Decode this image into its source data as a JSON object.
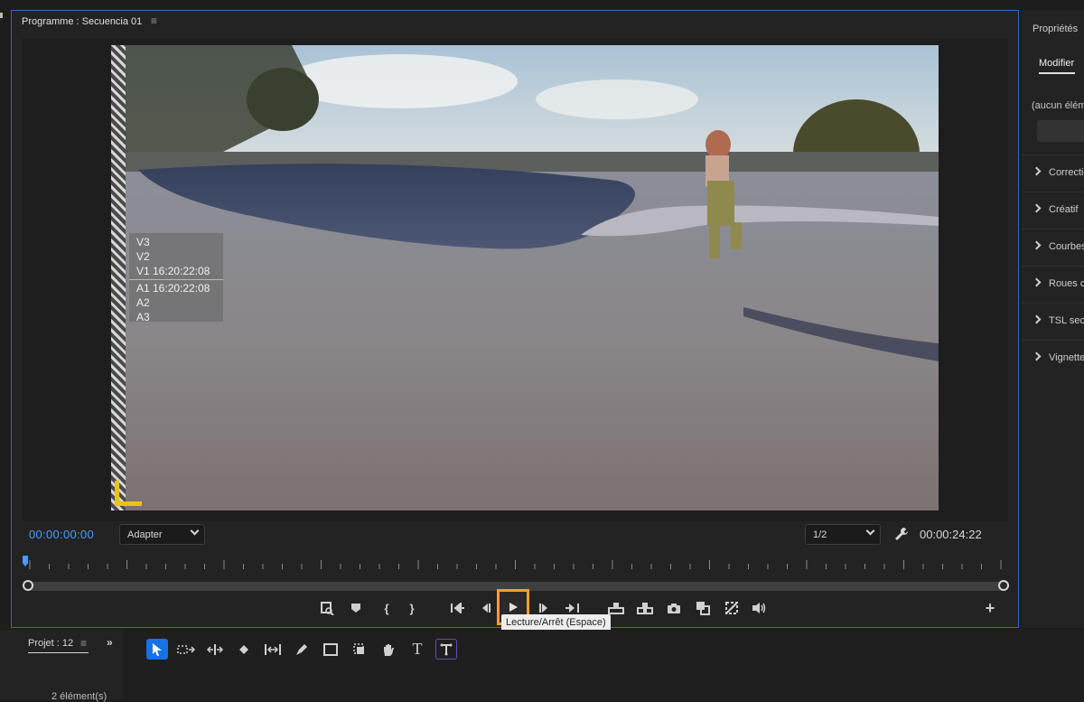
{
  "program_monitor": {
    "title": "Programme : Secuencia 01",
    "menu_icon": "hamburger-icon",
    "track_overlay": {
      "video": [
        "V3",
        "V2",
        "V1 16:20:22:08"
      ],
      "audio": [
        "A1 16:20:22:08",
        "A2",
        "A3"
      ]
    },
    "timecode_current": "00:00:00:00",
    "zoom_value": "Adapter",
    "resolution_value": "1/2",
    "timecode_duration": "00:00:24:22",
    "tooltip": "Lecture/Arrêt (Espace)",
    "accent_color": "#2e67d4",
    "highlight_color": "#f0a030",
    "transport_icons": [
      "export-frame-icon",
      "marker-icon",
      "mark-in-icon",
      "mark-out-icon",
      "go-to-in-icon",
      "step-back-icon",
      "play-icon",
      "step-forward-icon",
      "go-to-out-icon",
      "lift-icon",
      "extract-icon",
      "camera-icon",
      "compare-icon",
      "proxy-icon",
      "volume-icon",
      "add-icon"
    ]
  },
  "properties": {
    "title": "Propriétés",
    "tab": "Modifier",
    "empty_state": "(aucun élém",
    "sections": [
      "Correctio",
      "Créatif",
      "Courbes",
      "Roues c",
      "TSL sec",
      "Vignette"
    ]
  },
  "project": {
    "title": "Projet : 12",
    "count": "2 élément(s)"
  },
  "tools": [
    "selection-tool-icon",
    "track-select-icon",
    "ripple-edit-icon",
    "razor-icon",
    "slip-icon",
    "pen-icon",
    "rectangle-icon",
    "crop-icon",
    "hand-icon",
    "text-icon",
    "text-edit-icon"
  ]
}
